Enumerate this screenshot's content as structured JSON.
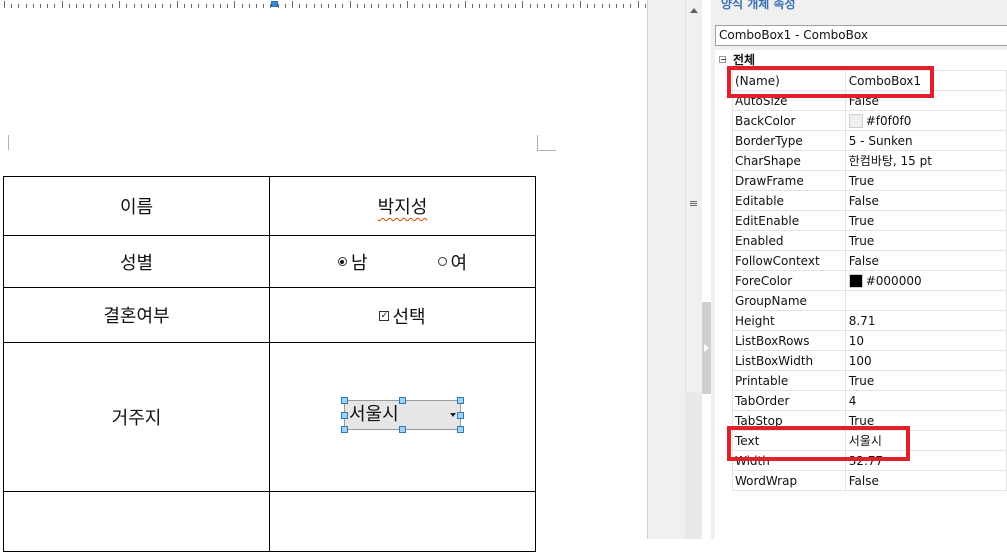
{
  "form_table": {
    "rows": [
      {
        "label": "이름",
        "value": "박지성"
      },
      {
        "label": "성별",
        "options": [
          "남",
          "여"
        ],
        "selected": "남"
      },
      {
        "label": "결혼여부",
        "checkbox": {
          "label": "선택",
          "checked": true,
          "mark": "✓"
        }
      },
      {
        "label": "거주지",
        "combo": {
          "value": "서울시"
        }
      },
      {
        "label": "",
        "value": ""
      }
    ]
  },
  "panel": {
    "title": "양식 개체 속성",
    "object_select": "ComboBox1 - ComboBox",
    "category": "전체",
    "category_toggle": "−",
    "scroll_grip": "≡",
    "properties": [
      {
        "name": "(Name)",
        "value": "ComboBox1"
      },
      {
        "name": "AutoSize",
        "value": "False"
      },
      {
        "name": "BackColor",
        "value": "#f0f0f0",
        "swatch": "#f0f0f0"
      },
      {
        "name": "BorderType",
        "value": "5 - Sunken"
      },
      {
        "name": "CharShape",
        "value": "한컴바탕, 15 pt"
      },
      {
        "name": "DrawFrame",
        "value": "True"
      },
      {
        "name": "Editable",
        "value": "False"
      },
      {
        "name": "EditEnable",
        "value": "True"
      },
      {
        "name": "Enabled",
        "value": "True"
      },
      {
        "name": "FollowContext",
        "value": "False"
      },
      {
        "name": "ForeColor",
        "value": "#000000",
        "swatch": "#000000"
      },
      {
        "name": "GroupName",
        "value": ""
      },
      {
        "name": "Height",
        "value": "8.71"
      },
      {
        "name": "ListBoxRows",
        "value": "10"
      },
      {
        "name": "ListBoxWidth",
        "value": "100"
      },
      {
        "name": "Printable",
        "value": "True"
      },
      {
        "name": "TabOrder",
        "value": "4"
      },
      {
        "name": "TabStop",
        "value": "True"
      },
      {
        "name": "Text",
        "value": "서울시"
      },
      {
        "name": "Width",
        "value": "32.77"
      },
      {
        "name": "WordWrap",
        "value": "False"
      }
    ]
  },
  "colors": {
    "highlight": "#e0202a",
    "panel_title": "#3a6fb5",
    "selection_handle": "#9fd3f5"
  }
}
